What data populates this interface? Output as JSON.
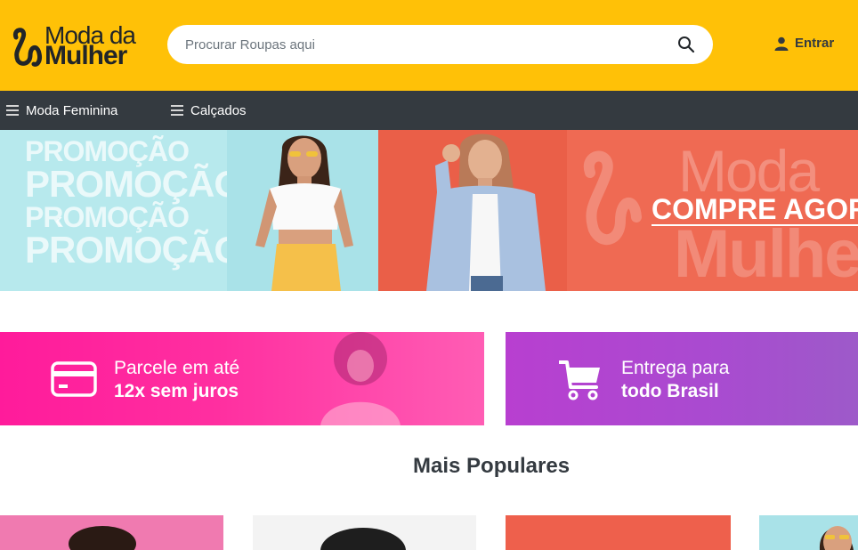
{
  "header": {
    "logo": {
      "line1": "Moda da",
      "line2": "Mulher"
    },
    "search": {
      "placeholder": "Procurar Roupas aqui",
      "value": ""
    },
    "login_label": "Entrar"
  },
  "nav": {
    "items": [
      {
        "label": "Moda Feminina"
      },
      {
        "label": "Calçados"
      }
    ]
  },
  "banner": {
    "promo_words": [
      "PROMOÇÃO",
      "PROMOÇÃO",
      "PROMOÇÃO",
      "PROMOÇÃO"
    ],
    "brand_watermark": [
      "Moda",
      "Mulher"
    ],
    "cta": "COMPRE AGORA"
  },
  "features": [
    {
      "icon": "credit-card-icon",
      "line1": "Parcele em até",
      "line2": "12x sem juros",
      "color": "#ff1b9b"
    },
    {
      "icon": "shopping-cart-icon",
      "line1": "Entrega para",
      "line2": "todo Brasil",
      "color": "#b83fd0"
    }
  ],
  "popular": {
    "title": "Mais Populares"
  },
  "colors": {
    "brand_yellow": "#ffc107",
    "nav_dark": "#343a40",
    "pink": "#ff1b9b",
    "purple": "#b83fd0"
  }
}
